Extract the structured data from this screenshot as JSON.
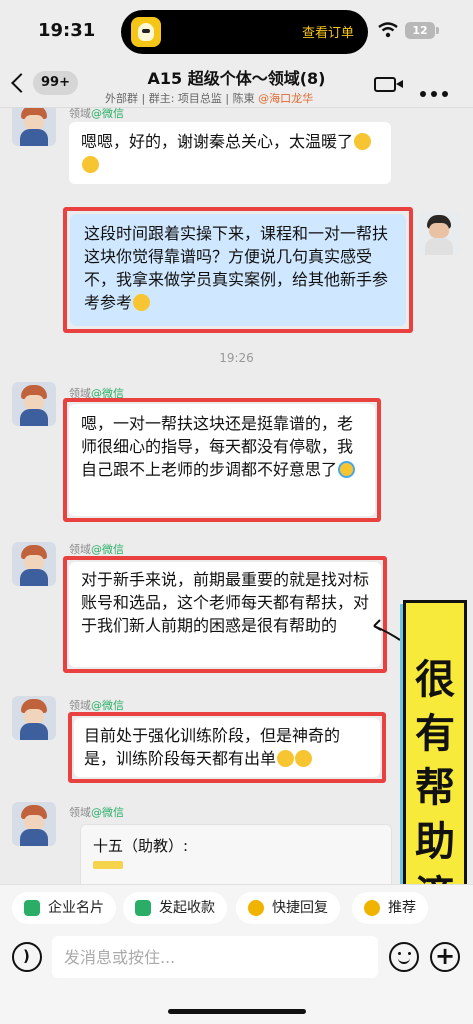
{
  "status_bar": {
    "time": "19:31",
    "island_text": "查看订单",
    "battery": "12"
  },
  "header": {
    "back_badge": "99+",
    "title": "A15 超级个体～领域(8)",
    "subtitle_plain": "外部群 | 群主: 项目总监 | 陈東 ",
    "subtitle_highlight": "@海口龙华"
  },
  "chat": {
    "timestamp": "19:26",
    "sender_name": "领域",
    "sender_source": "@微信",
    "messages": [
      {
        "side": "left",
        "text": "嗯嗯，好的，谢谢秦总关心，太温暖了",
        "emoji": [
          "grin",
          "grin"
        ]
      },
      {
        "side": "right",
        "text": "这段时间跟着实操下来，课程和一对一帮扶这块你觉得靠谱吗？方便说几句真实感受不，我拿来做学员真实案例，给其他新手参考参考",
        "emoji": [
          "grin"
        ]
      },
      {
        "side": "left",
        "text": "嗯，一对一帮扶这块还是挺靠谱的，老师很细心的指导，每天都没有停歇，我自己跟不上老师的步调都不好意思了",
        "emoji": [
          "cry-laugh"
        ]
      },
      {
        "side": "left",
        "text": "对于新手来说，前期最重要的就是找对标账号和选品，这个老师每天都有帮扶，对于我们新人前期的困惑是很有帮助的",
        "emoji": []
      },
      {
        "side": "left",
        "text": "目前处于强化训练阶段，但是神奇的是，训练阶段每天都有出单",
        "emoji": [
          "grin",
          "grin"
        ]
      }
    ],
    "quote_label": "十五（助教）:"
  },
  "banner": {
    "chars": [
      "很",
      "有",
      "帮",
      "助",
      "滴"
    ]
  },
  "quick_actions": [
    {
      "label": "企业名片",
      "color": "#2aae67"
    },
    {
      "label": "发起收款",
      "color": "#2aae67"
    },
    {
      "label": "快捷回复",
      "color": "#f0b400"
    },
    {
      "label": "推荐",
      "color": "#f0b400"
    }
  ],
  "input": {
    "placeholder": "发消息或按住..."
  }
}
